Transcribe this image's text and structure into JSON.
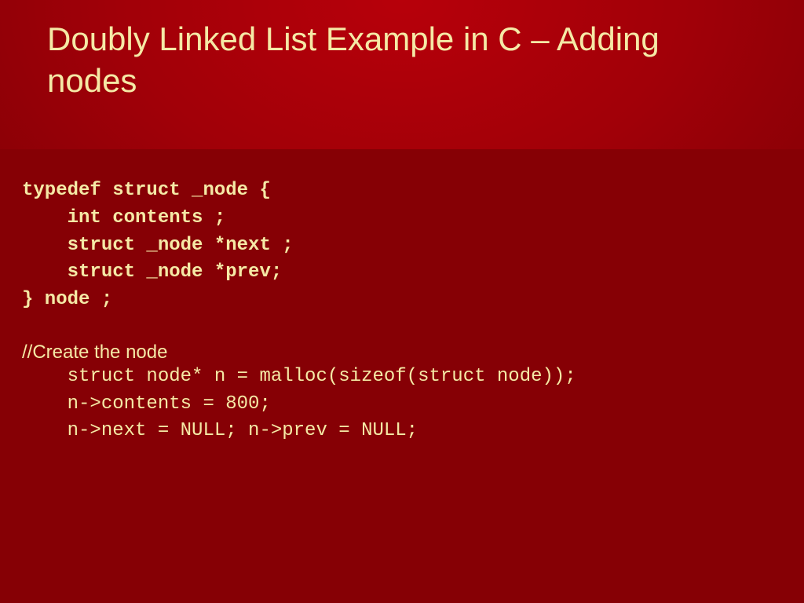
{
  "title": "Doubly Linked List Example in C – Adding nodes",
  "typedef": {
    "l1": "typedef struct _node {",
    "l2": "    int contents ;",
    "l3": "    struct _node *next ;",
    "l4": "    struct _node *prev;",
    "l5": "} node ;"
  },
  "comment": "//Create the node",
  "create": {
    "l1": "    struct node* n = malloc(sizeof(struct node));",
    "l2": "    n->contents = 800;",
    "l3": "    n->next = NULL; n->prev = NULL;"
  }
}
